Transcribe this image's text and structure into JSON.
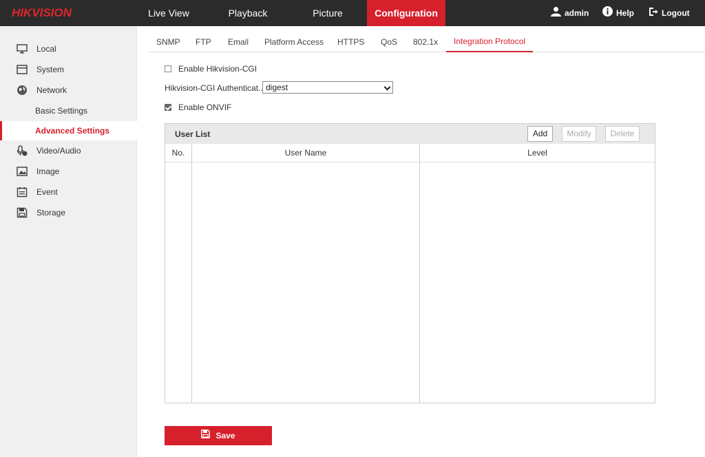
{
  "brand": {
    "logo_text": "HIKVISION",
    "accent": "#d6202c"
  },
  "topnav": {
    "items": [
      {
        "label": "Live View"
      },
      {
        "label": "Playback"
      },
      {
        "label": "Picture"
      },
      {
        "label": "Configuration",
        "active": true
      }
    ],
    "user": "admin",
    "help": "Help",
    "logout": "Logout"
  },
  "sidebar": {
    "items": [
      {
        "label": "Local",
        "icon": "monitor-icon"
      },
      {
        "label": "System",
        "icon": "window-icon"
      },
      {
        "label": "Network",
        "icon": "globe-icon"
      },
      {
        "label": "Video/Audio",
        "icon": "mic-icon"
      },
      {
        "label": "Image",
        "icon": "image-icon"
      },
      {
        "label": "Event",
        "icon": "calendar-icon"
      },
      {
        "label": "Storage",
        "icon": "floppy-icon"
      }
    ],
    "network_sub": [
      {
        "label": "Basic Settings"
      },
      {
        "label": "Advanced Settings",
        "active": true
      }
    ]
  },
  "tabs": [
    {
      "label": "SNMP"
    },
    {
      "label": "FTP"
    },
    {
      "label": "Email"
    },
    {
      "label": "Platform Access"
    },
    {
      "label": "HTTPS"
    },
    {
      "label": "QoS"
    },
    {
      "label": "802.1x"
    },
    {
      "label": "Integration Protocol",
      "active": true
    }
  ],
  "form": {
    "enable_cgi_label": "Enable Hikvision-CGI",
    "enable_cgi_checked": false,
    "auth_label": "Hikvision-CGI Authenticat...",
    "auth_value": "digest",
    "enable_onvif_label": "Enable ONVIF",
    "enable_onvif_checked": true
  },
  "user_list": {
    "title": "User List",
    "add": "Add",
    "modify": "Modify",
    "delete": "Delete",
    "columns": [
      "No.",
      "User Name",
      "Level"
    ],
    "rows": []
  },
  "save_label": "Save"
}
